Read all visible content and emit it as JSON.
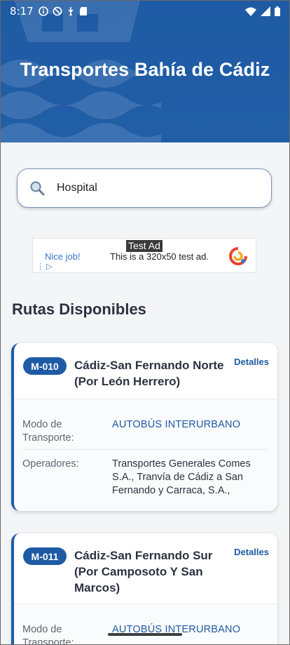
{
  "status_bar": {
    "time": "8:17"
  },
  "header": {
    "title": "Transportes Bahía de Cádiz"
  },
  "search": {
    "value": "Hospital",
    "placeholder": ""
  },
  "ad": {
    "label": "Test Ad",
    "headline": "Nice job!",
    "description": "This is a 320x50 test ad."
  },
  "section": {
    "title": "Rutas Disponibles"
  },
  "routes": [
    {
      "code": "M-010",
      "name": "Cádiz-San Fernando Norte (Por León Herrero)",
      "details_label": "Detalles",
      "mode_label": "Modo de Transporte:",
      "mode_value": "AUTOBÚS INTERURBANO",
      "operators_label": "Operadores:",
      "operators_value": "Transportes Generales Comes S.A., Tranvía de Cádiz a San Fernando y Carraca, S.A.,"
    },
    {
      "code": "M-011",
      "name": "Cádiz-San Fernando Sur (Por Camposoto Y San Marcos)",
      "details_label": "Detalles",
      "mode_label": "Modo de Transporte:",
      "mode_value": "AUTOBÚS INTERURBANO"
    }
  ],
  "colors": {
    "primary": "#1e5ba4",
    "background": "#f4f5f7"
  }
}
